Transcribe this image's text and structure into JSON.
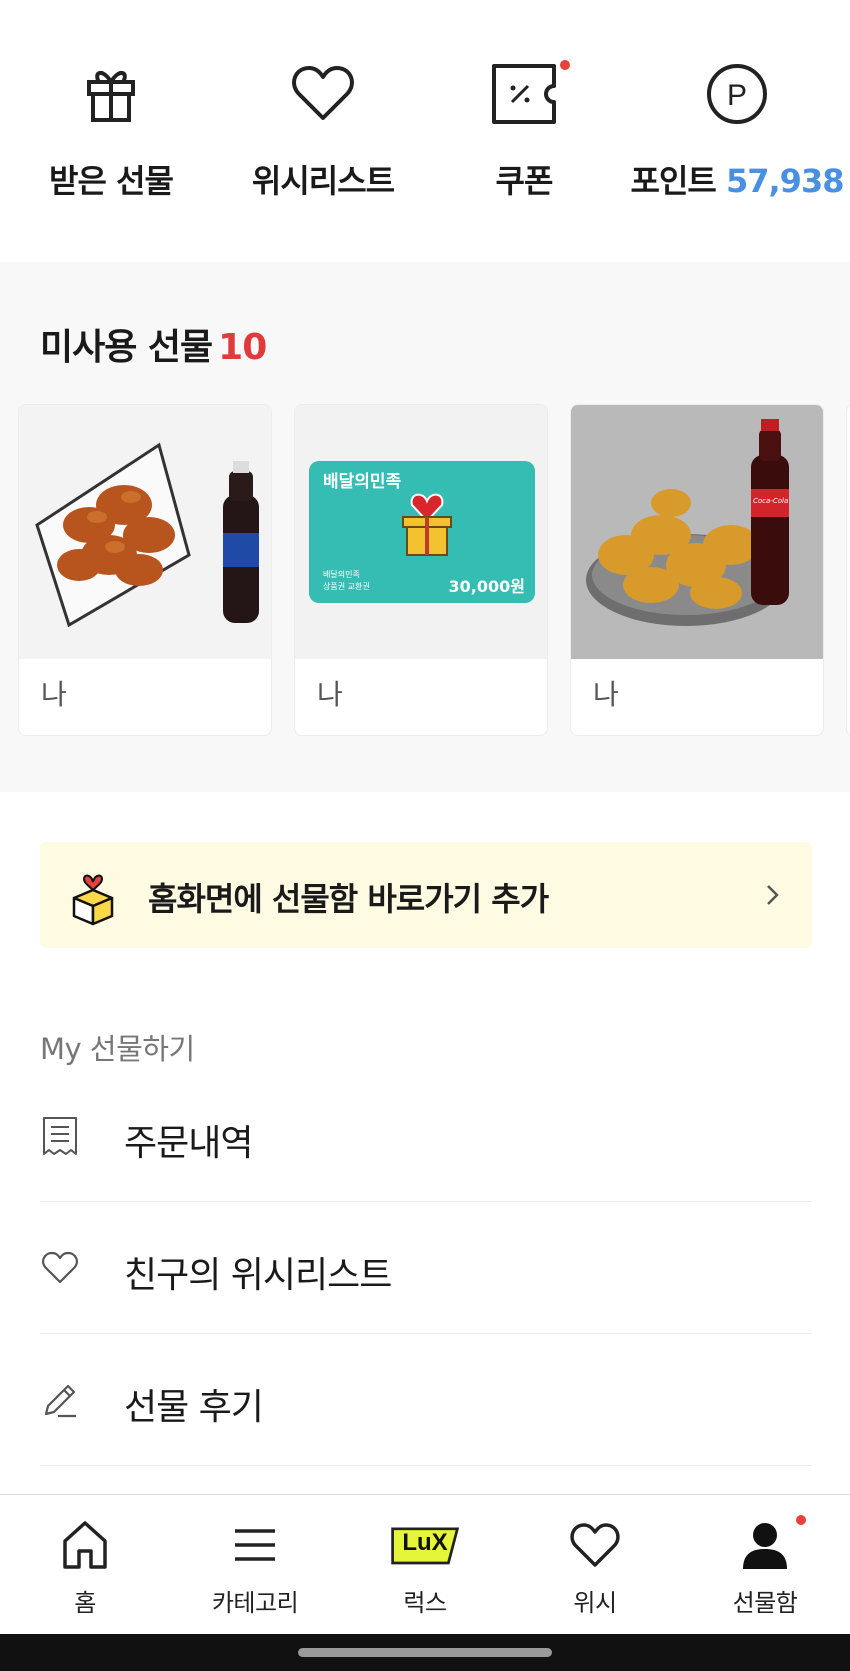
{
  "quick_menu": {
    "items": [
      {
        "label": "받은 선물",
        "icon": "gift-icon"
      },
      {
        "label": "위시리스트",
        "icon": "heart-icon"
      },
      {
        "label": "쿠폰",
        "icon": "coupon-icon",
        "has_new_dot": true
      },
      {
        "label": "포인트",
        "icon": "point-icon",
        "value": "57,938"
      }
    ]
  },
  "unused_gifts": {
    "title": "미사용 선물",
    "count": "10",
    "cards": [
      {
        "from": "나",
        "image": "fried-chicken-with-cola"
      },
      {
        "from": "나",
        "image": "baemin-gift-card",
        "brand_text": "배달의민족",
        "card_small_text_1": "배달의민족",
        "card_small_text_2": "상품권 교환권",
        "card_amount": "30,000원"
      },
      {
        "from": "나",
        "image": "crispy-chicken-with-coca-cola",
        "brand_text": "Coca-Cola"
      }
    ]
  },
  "banner": {
    "label": "홈화면에 선물함 바로가기 추가",
    "icon": "gift-box-heart-icon",
    "colors": {
      "background": "#fffbe3"
    }
  },
  "my_gift": {
    "section_label": "My 선물하기",
    "items": [
      {
        "label": "주문내역",
        "icon": "receipt-icon"
      },
      {
        "label": "친구의 위시리스트",
        "icon": "heart-outline-icon"
      },
      {
        "label": "선물 후기",
        "icon": "pencil-icon"
      }
    ]
  },
  "bottom_nav": {
    "items": [
      {
        "label": "홈",
        "icon": "home-icon"
      },
      {
        "label": "카테고리",
        "icon": "menu-icon"
      },
      {
        "label": "럭스",
        "icon": "lux-icon",
        "icon_text": "LuX"
      },
      {
        "label": "위시",
        "icon": "heart-icon"
      },
      {
        "label": "선물함",
        "icon": "person-icon",
        "has_new_dot": true,
        "selected": true
      }
    ]
  },
  "colors": {
    "accent_red": "#e03a3a",
    "points_blue": "#4a90e2",
    "lux_yellow": "#e4f53a"
  }
}
